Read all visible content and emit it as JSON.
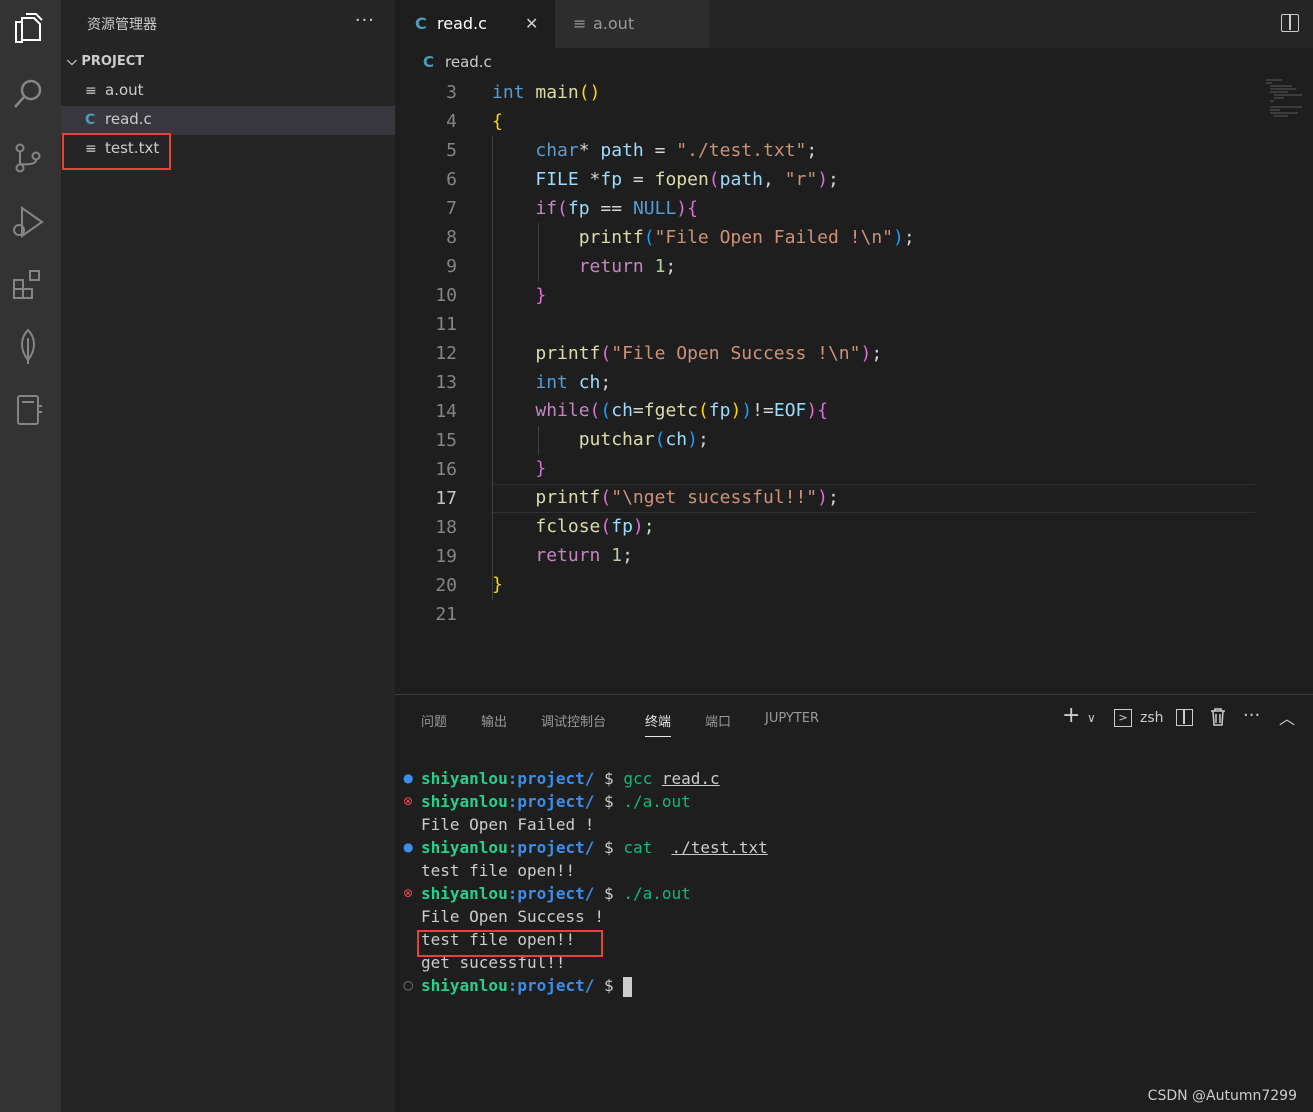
{
  "sidebar": {
    "title": "资源管理器",
    "more": "···",
    "project": "PROJECT",
    "files": [
      "a.out",
      "read.c",
      "test.txt"
    ]
  },
  "tabs": [
    {
      "label": "read.c",
      "close": "✕"
    },
    {
      "label": "a.out"
    }
  ],
  "breadcrumb": "read.c",
  "line_numbers": [
    "3",
    "4",
    "5",
    "6",
    "7",
    "8",
    "9",
    "10",
    "11",
    "12",
    "13",
    "14",
    "15",
    "16",
    "17",
    "18",
    "19",
    "20",
    "21"
  ],
  "panel": {
    "tabs": [
      "问题",
      "输出",
      "调试控制台",
      "终端",
      "端口",
      "JUPYTER"
    ],
    "shell": "zsh"
  },
  "terminal": {
    "user": "shiyanlou",
    "path": "project/",
    "lines": [
      {
        "cmd": "gcc",
        "arg": "read.c"
      },
      {
        "cmd": "./a.out"
      },
      {
        "out": "File Open Failed !"
      },
      {
        "cmd": "cat",
        "arg": "./test.txt"
      },
      {
        "out": "test file open!!"
      },
      {
        "cmd": "./a.out"
      },
      {
        "out": "File Open Success !"
      },
      {
        "out": "test file open!!"
      },
      {
        "out": "get sucessful!!"
      }
    ]
  },
  "watermark": "CSDN @Autumn7299",
  "colors": {
    "accent": "#519aba",
    "highlight_box": "#e8403e",
    "prompt_user": "#23d18b",
    "prompt_path": "#3b8eea"
  }
}
